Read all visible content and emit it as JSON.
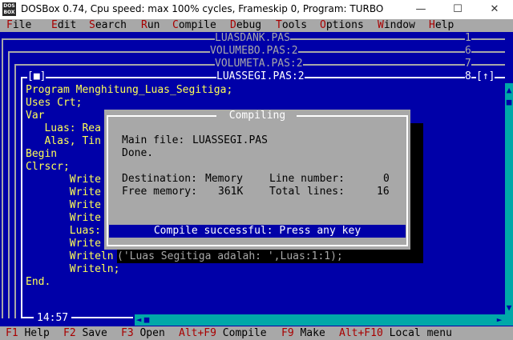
{
  "window": {
    "icon_text": "DOS BOX",
    "title": "DOSBox 0.74, Cpu speed: max 100% cycles, Frameskip  0, Program:    TURBO",
    "minimize": "—",
    "maximize": "☐",
    "close": "✕"
  },
  "menu": {
    "file": {
      "hk": "F",
      "rest": "ile"
    },
    "edit": {
      "hk": "E",
      "rest": "dit"
    },
    "search": {
      "hk": "S",
      "rest": "earch"
    },
    "run": {
      "hk": "R",
      "rest": "un"
    },
    "compile": {
      "hk": "C",
      "rest": "ompile"
    },
    "debug": {
      "hk": "D",
      "rest": "ebug"
    },
    "tools": {
      "hk": "T",
      "rest": "ools"
    },
    "options": {
      "hk": "O",
      "rest": "ptions"
    },
    "window": {
      "hk": "W",
      "rest": "indow"
    },
    "help": {
      "hk": "H",
      "rest": "elp"
    }
  },
  "windows": [
    {
      "name": "LUASDANK.PAS",
      "number": "1"
    },
    {
      "name": "VOLUMEBO.PAS:2",
      "number": "6"
    },
    {
      "name": "VOLUMETA.PAS:2",
      "number": "7"
    },
    {
      "name": "LUASSEGI.PAS:2",
      "number": "8"
    }
  ],
  "editor": {
    "close_box": "[■]",
    "zoom_box": "[↑]",
    "cursor_pos": "14:57",
    "lines": [
      "Program Menghitung_Luas_Segitiga;",
      "Uses Crt;",
      "Var",
      "   Luas: Rea",
      "   Alas, Tin",
      "Begin",
      "Clrscr;",
      "       Write",
      "       Write",
      "       Write",
      "       Write",
      "       Luas:",
      "       Write",
      "       Writeln",
      "       Writeln;",
      "End."
    ],
    "shadow_text": "('Luas Segitiga adalah: ',Luas:1:1);"
  },
  "dialog": {
    "title": "Compiling",
    "main_file_label": "Main file:",
    "main_file": "LUASSEGI.PAS",
    "state": "Done.",
    "destination_label": "Destination:",
    "destination": "Memory",
    "line_number_label": "Line number:",
    "line_number": "0",
    "free_memory_label": "Free memory:",
    "free_memory": "361K",
    "total_lines_label": "Total lines:",
    "total_lines": "16",
    "status": "Compile successful: Press any key"
  },
  "statusbar": {
    "help": {
      "key": "F1",
      "label": " Help"
    },
    "save": {
      "key": "F2",
      "label": " Save"
    },
    "open": {
      "key": "F3",
      "label": " Open"
    },
    "compile": {
      "key": "Alt+F9",
      "label": " Compile"
    },
    "make": {
      "key": "F9",
      "label": " Make"
    },
    "local_menu": {
      "key": "Alt+F10",
      "label": " Local menu"
    }
  },
  "colors": {
    "dos_blue": "#0000a8",
    "dos_gray": "#a8a8a8",
    "dos_yellow": "#ffff55",
    "dos_red": "#a80000",
    "dos_cyan": "#00a8a8"
  }
}
